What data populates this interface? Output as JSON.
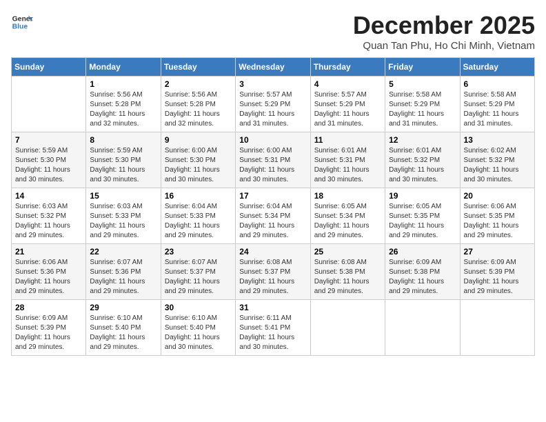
{
  "header": {
    "logo_line1": "General",
    "logo_line2": "Blue",
    "title": "December 2025",
    "subtitle": "Quan Tan Phu, Ho Chi Minh, Vietnam"
  },
  "calendar": {
    "days_of_week": [
      "Sunday",
      "Monday",
      "Tuesday",
      "Wednesday",
      "Thursday",
      "Friday",
      "Saturday"
    ],
    "weeks": [
      [
        {
          "day": "",
          "sunrise": "",
          "sunset": "",
          "daylight": ""
        },
        {
          "day": "1",
          "sunrise": "Sunrise: 5:56 AM",
          "sunset": "Sunset: 5:28 PM",
          "daylight": "Daylight: 11 hours and 32 minutes."
        },
        {
          "day": "2",
          "sunrise": "Sunrise: 5:56 AM",
          "sunset": "Sunset: 5:28 PM",
          "daylight": "Daylight: 11 hours and 32 minutes."
        },
        {
          "day": "3",
          "sunrise": "Sunrise: 5:57 AM",
          "sunset": "Sunset: 5:29 PM",
          "daylight": "Daylight: 11 hours and 31 minutes."
        },
        {
          "day": "4",
          "sunrise": "Sunrise: 5:57 AM",
          "sunset": "Sunset: 5:29 PM",
          "daylight": "Daylight: 11 hours and 31 minutes."
        },
        {
          "day": "5",
          "sunrise": "Sunrise: 5:58 AM",
          "sunset": "Sunset: 5:29 PM",
          "daylight": "Daylight: 11 hours and 31 minutes."
        },
        {
          "day": "6",
          "sunrise": "Sunrise: 5:58 AM",
          "sunset": "Sunset: 5:29 PM",
          "daylight": "Daylight: 11 hours and 31 minutes."
        }
      ],
      [
        {
          "day": "7",
          "sunrise": "Sunrise: 5:59 AM",
          "sunset": "Sunset: 5:30 PM",
          "daylight": "Daylight: 11 hours and 30 minutes."
        },
        {
          "day": "8",
          "sunrise": "Sunrise: 5:59 AM",
          "sunset": "Sunset: 5:30 PM",
          "daylight": "Daylight: 11 hours and 30 minutes."
        },
        {
          "day": "9",
          "sunrise": "Sunrise: 6:00 AM",
          "sunset": "Sunset: 5:30 PM",
          "daylight": "Daylight: 11 hours and 30 minutes."
        },
        {
          "day": "10",
          "sunrise": "Sunrise: 6:00 AM",
          "sunset": "Sunset: 5:31 PM",
          "daylight": "Daylight: 11 hours and 30 minutes."
        },
        {
          "day": "11",
          "sunrise": "Sunrise: 6:01 AM",
          "sunset": "Sunset: 5:31 PM",
          "daylight": "Daylight: 11 hours and 30 minutes."
        },
        {
          "day": "12",
          "sunrise": "Sunrise: 6:01 AM",
          "sunset": "Sunset: 5:32 PM",
          "daylight": "Daylight: 11 hours and 30 minutes."
        },
        {
          "day": "13",
          "sunrise": "Sunrise: 6:02 AM",
          "sunset": "Sunset: 5:32 PM",
          "daylight": "Daylight: 11 hours and 30 minutes."
        }
      ],
      [
        {
          "day": "14",
          "sunrise": "Sunrise: 6:03 AM",
          "sunset": "Sunset: 5:32 PM",
          "daylight": "Daylight: 11 hours and 29 minutes."
        },
        {
          "day": "15",
          "sunrise": "Sunrise: 6:03 AM",
          "sunset": "Sunset: 5:33 PM",
          "daylight": "Daylight: 11 hours and 29 minutes."
        },
        {
          "day": "16",
          "sunrise": "Sunrise: 6:04 AM",
          "sunset": "Sunset: 5:33 PM",
          "daylight": "Daylight: 11 hours and 29 minutes."
        },
        {
          "day": "17",
          "sunrise": "Sunrise: 6:04 AM",
          "sunset": "Sunset: 5:34 PM",
          "daylight": "Daylight: 11 hours and 29 minutes."
        },
        {
          "day": "18",
          "sunrise": "Sunrise: 6:05 AM",
          "sunset": "Sunset: 5:34 PM",
          "daylight": "Daylight: 11 hours and 29 minutes."
        },
        {
          "day": "19",
          "sunrise": "Sunrise: 6:05 AM",
          "sunset": "Sunset: 5:35 PM",
          "daylight": "Daylight: 11 hours and 29 minutes."
        },
        {
          "day": "20",
          "sunrise": "Sunrise: 6:06 AM",
          "sunset": "Sunset: 5:35 PM",
          "daylight": "Daylight: 11 hours and 29 minutes."
        }
      ],
      [
        {
          "day": "21",
          "sunrise": "Sunrise: 6:06 AM",
          "sunset": "Sunset: 5:36 PM",
          "daylight": "Daylight: 11 hours and 29 minutes."
        },
        {
          "day": "22",
          "sunrise": "Sunrise: 6:07 AM",
          "sunset": "Sunset: 5:36 PM",
          "daylight": "Daylight: 11 hours and 29 minutes."
        },
        {
          "day": "23",
          "sunrise": "Sunrise: 6:07 AM",
          "sunset": "Sunset: 5:37 PM",
          "daylight": "Daylight: 11 hours and 29 minutes."
        },
        {
          "day": "24",
          "sunrise": "Sunrise: 6:08 AM",
          "sunset": "Sunset: 5:37 PM",
          "daylight": "Daylight: 11 hours and 29 minutes."
        },
        {
          "day": "25",
          "sunrise": "Sunrise: 6:08 AM",
          "sunset": "Sunset: 5:38 PM",
          "daylight": "Daylight: 11 hours and 29 minutes."
        },
        {
          "day": "26",
          "sunrise": "Sunrise: 6:09 AM",
          "sunset": "Sunset: 5:38 PM",
          "daylight": "Daylight: 11 hours and 29 minutes."
        },
        {
          "day": "27",
          "sunrise": "Sunrise: 6:09 AM",
          "sunset": "Sunset: 5:39 PM",
          "daylight": "Daylight: 11 hours and 29 minutes."
        }
      ],
      [
        {
          "day": "28",
          "sunrise": "Sunrise: 6:09 AM",
          "sunset": "Sunset: 5:39 PM",
          "daylight": "Daylight: 11 hours and 29 minutes."
        },
        {
          "day": "29",
          "sunrise": "Sunrise: 6:10 AM",
          "sunset": "Sunset: 5:40 PM",
          "daylight": "Daylight: 11 hours and 29 minutes."
        },
        {
          "day": "30",
          "sunrise": "Sunrise: 6:10 AM",
          "sunset": "Sunset: 5:40 PM",
          "daylight": "Daylight: 11 hours and 30 minutes."
        },
        {
          "day": "31",
          "sunrise": "Sunrise: 6:11 AM",
          "sunset": "Sunset: 5:41 PM",
          "daylight": "Daylight: 11 hours and 30 minutes."
        },
        {
          "day": "",
          "sunrise": "",
          "sunset": "",
          "daylight": ""
        },
        {
          "day": "",
          "sunrise": "",
          "sunset": "",
          "daylight": ""
        },
        {
          "day": "",
          "sunrise": "",
          "sunset": "",
          "daylight": ""
        }
      ]
    ]
  }
}
